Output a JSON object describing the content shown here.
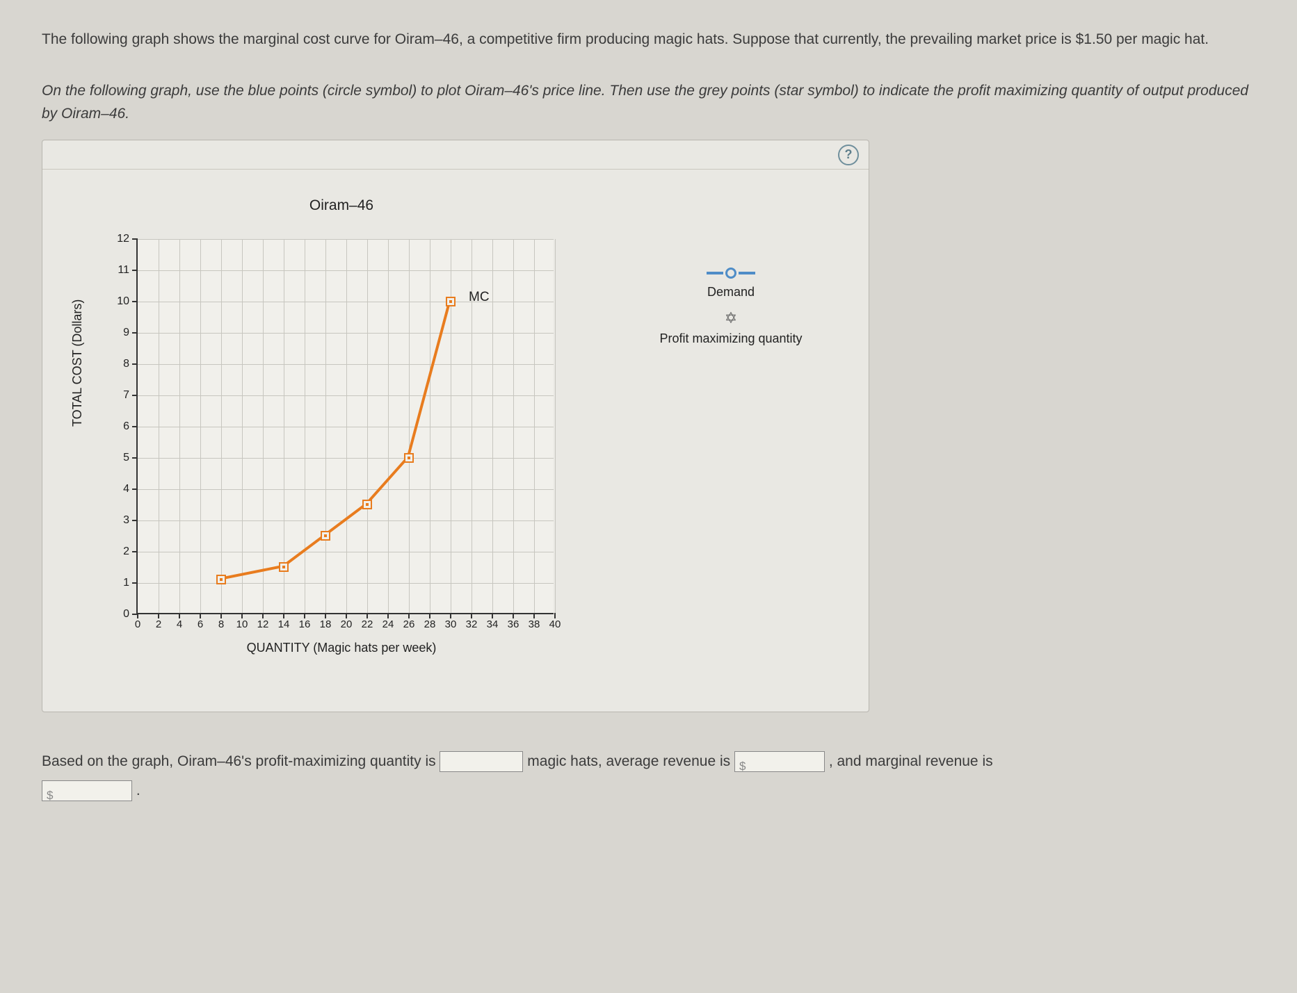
{
  "intro_text": "The following graph shows the marginal cost curve for Oiram–46, a competitive firm producing magic hats. Suppose that currently, the prevailing market price is $1.50 per magic hat.",
  "instruction_text": "On the following graph, use the blue points (circle symbol) to plot Oiram–46's price line. Then use the grey points (star symbol) to indicate the profit maximizing quantity of output produced by Oiram–46.",
  "help_label": "?",
  "chart_data": {
    "type": "line",
    "title": "Oiram–46",
    "xlabel": "QUANTITY (Magic hats per week)",
    "ylabel": "TOTAL COST (Dollars)",
    "xlim": [
      0,
      40
    ],
    "ylim": [
      0,
      12
    ],
    "xticks": [
      0,
      2,
      4,
      6,
      8,
      10,
      12,
      14,
      16,
      18,
      20,
      22,
      24,
      26,
      28,
      30,
      32,
      34,
      36,
      38,
      40
    ],
    "yticks": [
      0,
      1,
      2,
      3,
      4,
      5,
      6,
      7,
      8,
      9,
      10,
      11,
      12
    ],
    "series": [
      {
        "name": "MC",
        "color": "#e87c1e",
        "x": [
          8,
          14,
          18,
          22,
          26,
          30
        ],
        "y": [
          1.1,
          1.5,
          2.5,
          3.5,
          5.0,
          10.0
        ]
      }
    ]
  },
  "legend": {
    "demand_label": "Demand",
    "pmq_label": "Profit maximizing quantity"
  },
  "question": {
    "part1": "Based on the graph, Oiram–46's profit-maximizing quantity is ",
    "part2": " magic hats, average revenue is ",
    "part3": " , and marginal revenue is",
    "part4": " .",
    "dollar_prefix": "$",
    "q_value": "",
    "ar_value": "",
    "mr_value": ""
  }
}
